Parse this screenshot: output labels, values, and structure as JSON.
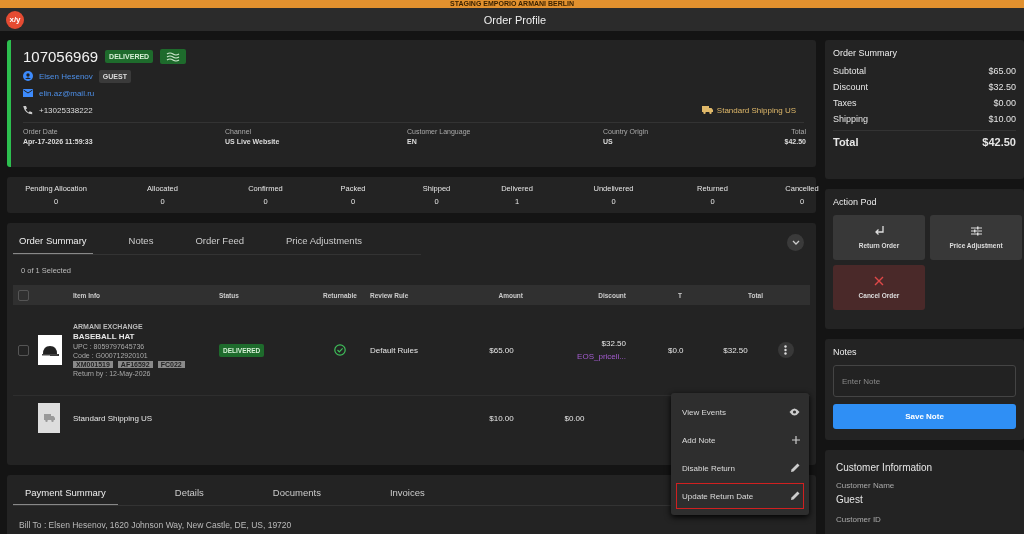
{
  "banner": "STAGING EMPORIO ARMANI BERLIN",
  "header": {
    "logo": "x/y",
    "title": "Order Profile"
  },
  "order": {
    "number": "107056969",
    "status": "DELIVERED",
    "customer": "Elsen Hesenov",
    "customer_tag": "GUEST",
    "email": "elin.az@mail.ru",
    "phone": "+13025338222",
    "shipping_method": "Standard Shipping US",
    "fields": [
      {
        "label": "Order Date",
        "value": "Apr-17-2026 11:59:33"
      },
      {
        "label": "Channel",
        "value": "US Live Website"
      },
      {
        "label": "Customer Language",
        "value": "EN"
      },
      {
        "label": "Country Origin",
        "value": "US"
      },
      {
        "label": "Total",
        "value": "$42.50"
      }
    ]
  },
  "status_counts": [
    {
      "label": "Pending Allocation",
      "count": "0"
    },
    {
      "label": "Allocated",
      "count": "0"
    },
    {
      "label": "Confirmed",
      "count": "0"
    },
    {
      "label": "Packed",
      "count": "0"
    },
    {
      "label": "Shipped",
      "count": "0"
    },
    {
      "label": "Delivered",
      "count": "1"
    },
    {
      "label": "Undelivered",
      "count": "0"
    },
    {
      "label": "Returned",
      "count": "0"
    },
    {
      "label": "Cancelled",
      "count": "0"
    }
  ],
  "items_panel": {
    "tabs": [
      {
        "label": "Order Summary",
        "selected": true
      },
      {
        "label": "Notes",
        "selected": false
      },
      {
        "label": "Order Feed",
        "selected": false
      },
      {
        "label": "Price Adjustments",
        "selected": false
      }
    ],
    "selection": "0 of 1 Selected",
    "select_all_checked": false,
    "columns": [
      "Item Info",
      "Status",
      "Returnable",
      "Review Rule",
      "Amount",
      "Discount",
      "T",
      "Total"
    ],
    "rows": [
      {
        "kind": "product",
        "checked": false,
        "brand": "ARMANI EXCHANGE",
        "name": "BASEBALL HAT",
        "upc": "UPC : 8059797645736",
        "code": "Code : G000712920101",
        "tags": [
          "XM001519",
          "AF16592",
          "FC022"
        ],
        "return_by": "Return by : 12-May-2026",
        "status": "DELIVERED",
        "returnable": true,
        "review_rule": "Default Rules",
        "amount": "$65.00",
        "discount": "$32.50",
        "promotion": "EOS_priceli...",
        "tax": "$0.0",
        "total": "$32.50"
      },
      {
        "kind": "shipping",
        "name": "Standard Shipping US",
        "amount": "$10.00",
        "discount": "$0.00"
      }
    ],
    "row_menu": [
      {
        "label": "View Events",
        "kind": "view",
        "highlighted": false
      },
      {
        "label": "Add Note",
        "kind": "add",
        "highlighted": false
      },
      {
        "label": "Disable Return",
        "kind": "edit",
        "highlighted": false
      },
      {
        "label": "Update Return Date",
        "kind": "edit",
        "highlighted": true
      }
    ]
  },
  "payment_panel": {
    "tabs": [
      {
        "label": "Payment Summary",
        "selected": true
      },
      {
        "label": "Details",
        "selected": false
      },
      {
        "label": "Documents",
        "selected": false
      },
      {
        "label": "Invoices",
        "selected": false
      }
    ],
    "bill_to": "Bill To : Elsen Hesenov, 1620 Johnson Way, New Castle, DE, US, 19720"
  },
  "order_summary": {
    "title": "Order Summary",
    "rows": [
      {
        "label": "Subtotal",
        "value": "$65.00"
      },
      {
        "label": "Discount",
        "value": "$32.50"
      },
      {
        "label": "Taxes",
        "value": "$0.00"
      },
      {
        "label": "Shipping",
        "value": "$10.00"
      }
    ],
    "total_label": "Total",
    "total_value": "$42.50"
  },
  "action_pod": {
    "title": "Action Pod",
    "actions": [
      {
        "label": "Return Order",
        "kind": "return"
      },
      {
        "label": "Price Adjustment",
        "kind": "adjust"
      },
      {
        "label": "Cancel Order",
        "kind": "cancel"
      }
    ]
  },
  "notes": {
    "title": "Notes",
    "placeholder": "Enter Note",
    "button": "Save Note"
  },
  "customer_info": {
    "title": "Customer Information",
    "name_label": "Customer Name",
    "name": "Guest",
    "id_label": "Customer ID"
  }
}
